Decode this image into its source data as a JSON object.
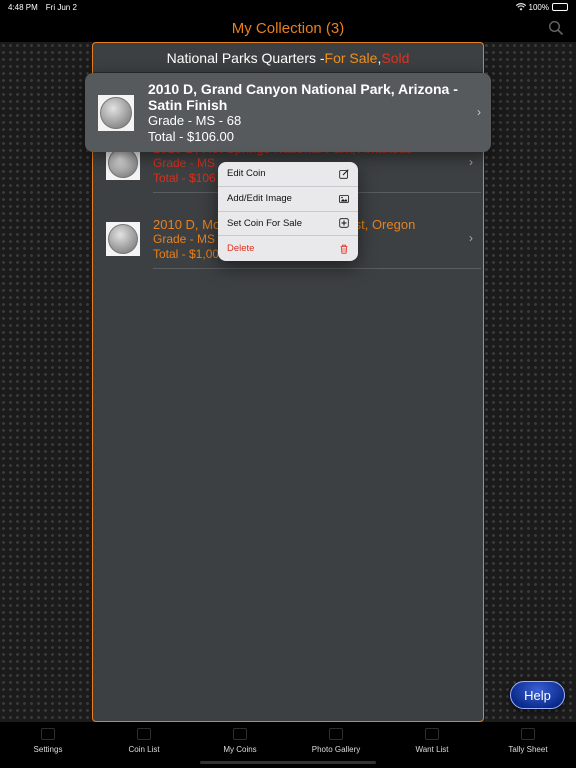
{
  "status_bar": {
    "time": "4:48 PM",
    "date": "Fri Jun 2",
    "battery": "100%"
  },
  "nav": {
    "title": "My Collection (3)",
    "search_icon": "search-icon"
  },
  "panel": {
    "header_prefix": "National Parks Quarters - ",
    "header_forsale": "For Sale",
    "header_sep": ", ",
    "header_sold": "Sold"
  },
  "highlighted_coin": {
    "title_line1": "2010 D, Grand Canyon National Park, Arizona -",
    "title_line2": "Satin Finish",
    "grade": "Grade - MS - 68",
    "total": "Total - $106.00"
  },
  "coins": [
    {
      "title": "2010 D, Hot Springs National Park, Arkansas",
      "grade": "Grade - MS",
      "total": "Total - $106"
    },
    {
      "title": "2010 D, Mount Hood National Forest, Oregon",
      "grade": "Grade - MS",
      "total": "Total - $1,00"
    }
  ],
  "context_menu": [
    {
      "label": "Edit Coin",
      "icon": "edit-icon"
    },
    {
      "label": "Add/Edit Image",
      "icon": "image-icon"
    },
    {
      "label": "Set Coin For Sale",
      "icon": "plus-square-icon"
    },
    {
      "label": "Delete",
      "icon": "trash-icon"
    }
  ],
  "help_label": "Help",
  "tabs": [
    {
      "label": "Settings"
    },
    {
      "label": "Coin List"
    },
    {
      "label": "My Coins"
    },
    {
      "label": "Photo Gallery"
    },
    {
      "label": "Want List"
    },
    {
      "label": "Tally Sheet"
    }
  ],
  "colors": {
    "accent": "#e8801f",
    "sold": "#e0311f",
    "panel": "#3d4042"
  }
}
